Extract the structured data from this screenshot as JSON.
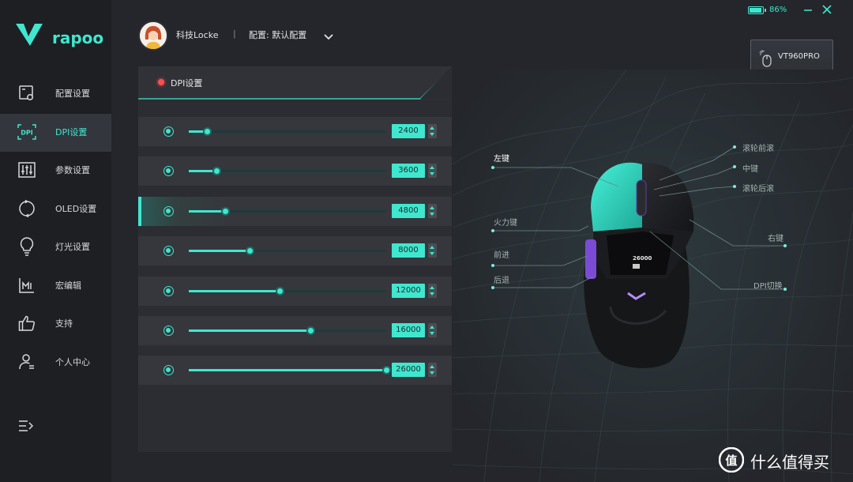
{
  "app": {
    "logo_text": "rapoo"
  },
  "sidebar": {
    "items": [
      {
        "label": "配置设置",
        "icon": "config-settings-icon",
        "active": false
      },
      {
        "label": "DPI设置",
        "icon": "dpi-icon",
        "active": true
      },
      {
        "label": "参数设置",
        "icon": "sliders-icon",
        "active": false
      },
      {
        "label": "OLED设置",
        "icon": "oled-refresh-icon",
        "active": false
      },
      {
        "label": "灯光设置",
        "icon": "lightbulb-icon",
        "active": false
      },
      {
        "label": "宏编辑",
        "icon": "macro-icon",
        "active": false
      },
      {
        "label": "支持",
        "icon": "thumbs-up-icon",
        "active": false
      },
      {
        "label": "个人中心",
        "icon": "user-icon",
        "active": false
      }
    ],
    "menu_icon": "collapse-menu-icon"
  },
  "header": {
    "username": "科技Locke",
    "separator": "|",
    "config_label": "配置: 默认配置",
    "battery_text": "86%",
    "battery_level": 0.86
  },
  "device": {
    "model": "VT960PRO",
    "type": "MOUSE"
  },
  "dpi_panel": {
    "title": "DPI设置",
    "max_dpi": 26000,
    "rows": [
      {
        "value": "2400",
        "active": false
      },
      {
        "value": "3600",
        "active": false
      },
      {
        "value": "4800",
        "active": true
      },
      {
        "value": "8000",
        "active": false
      },
      {
        "value": "12000",
        "active": false
      },
      {
        "value": "16000",
        "active": false
      },
      {
        "value": "26000",
        "active": false
      }
    ]
  },
  "mouse": {
    "oled_text": "26000",
    "annotations": {
      "left_button": "左键",
      "scroll_forward": "滚轮前滚",
      "middle_button": "中键",
      "scroll_back": "滚轮后滚",
      "fire_button": "火力键",
      "right_button": "右键",
      "forward": "前进",
      "back": "后退",
      "dpi_switch": "DPI切换"
    }
  },
  "watermark": {
    "text": "什么值得买",
    "icon_char": "值"
  },
  "colors": {
    "accent": "#3fe7cf",
    "background": "#24262b",
    "sidebar": "#1d1f23",
    "record_dot": "#ff4d52"
  }
}
